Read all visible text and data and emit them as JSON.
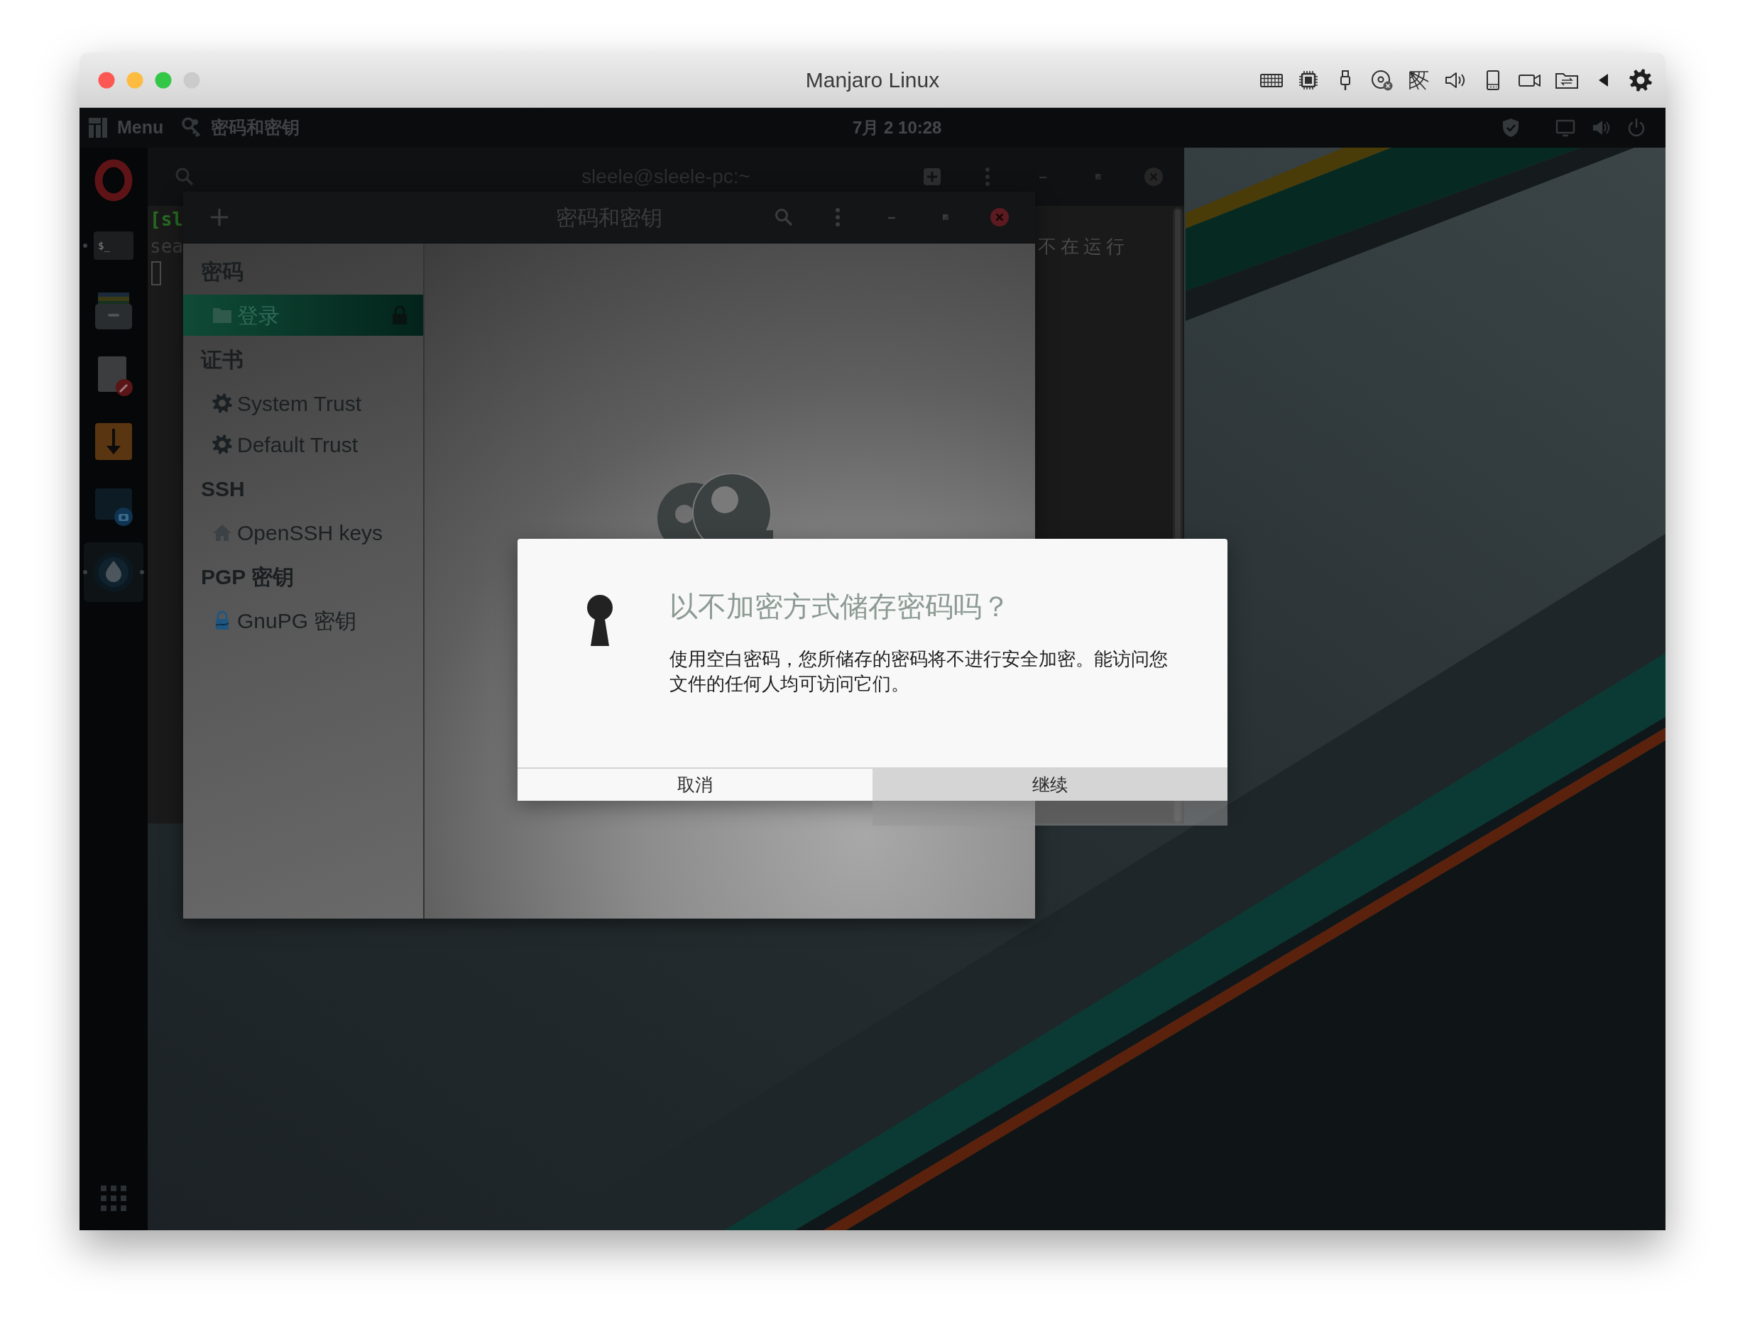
{
  "window": {
    "title": "Manjaro Linux"
  },
  "panel": {
    "menu_label": "Menu",
    "app_name": "密码和密钥",
    "clock": "7月 2 10:28"
  },
  "dock": [
    {
      "kind": "browser",
      "running": false,
      "active": false
    },
    {
      "kind": "terminal",
      "glyph": "$_",
      "running": true,
      "active": false
    },
    {
      "kind": "files",
      "running": false,
      "active": false
    },
    {
      "kind": "editor",
      "running": false,
      "active": false
    },
    {
      "kind": "download",
      "running": false,
      "active": false
    },
    {
      "kind": "screenshot",
      "running": false,
      "active": false
    },
    {
      "kind": "keyring",
      "running": true,
      "active": true
    }
  ],
  "terminal": {
    "title": "sleele@sleele-pc:~",
    "lines": [
      {
        "kind": "prompt",
        "text": "[sl"
      },
      {
        "kind": "output",
        "text": "sea",
        "tail": "不在运行"
      }
    ],
    "cursor_visible": true
  },
  "app": {
    "title": "密码和密钥",
    "sections": [
      {
        "heading": "密码",
        "items": [
          {
            "label": "登录",
            "kind": "folder",
            "selected": true,
            "locked": true
          }
        ]
      },
      {
        "heading": "证书",
        "items": [
          {
            "label": "System Trust",
            "kind": "gear",
            "selected": false,
            "locked": false
          },
          {
            "label": "Default Trust",
            "kind": "gear",
            "selected": false,
            "locked": false
          }
        ]
      },
      {
        "heading": "SSH",
        "items": [
          {
            "label": "OpenSSH keys",
            "kind": "home",
            "selected": false,
            "locked": false
          }
        ]
      },
      {
        "heading": "PGP 密钥",
        "items": [
          {
            "label": "GnuPG 密钥",
            "kind": "gnupg",
            "selected": false,
            "locked": false
          }
        ]
      }
    ]
  },
  "dialog": {
    "title": "以不加密方式储存密码吗？",
    "message": "使用空白密码，您所储存的密码将不进行安全加密。能访问您文件的任何人均可访问它们。",
    "buttons": [
      {
        "label": "取消",
        "highlighted": false
      },
      {
        "label": "继续",
        "highlighted": true
      }
    ]
  }
}
